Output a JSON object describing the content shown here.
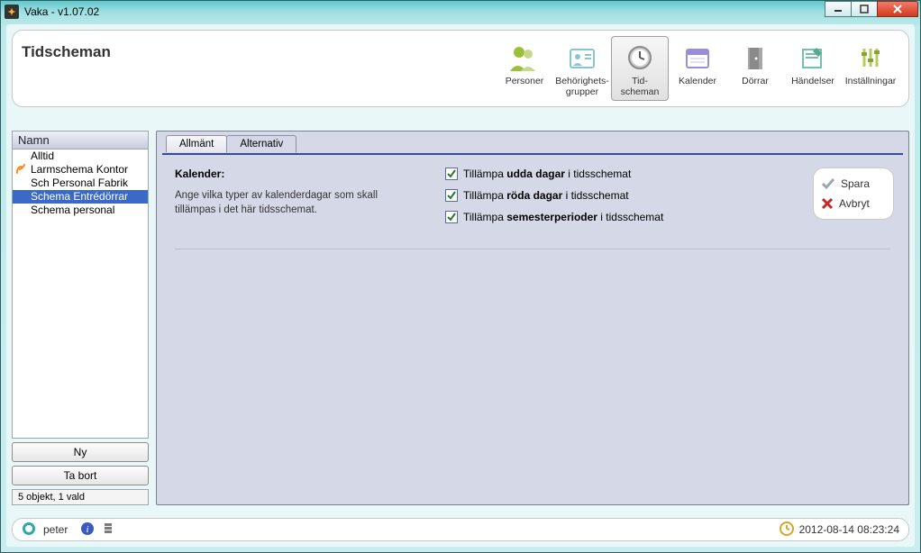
{
  "window": {
    "title": "Vaka - v1.07.02"
  },
  "toolbar": {
    "title": "Tidscheman",
    "buttons": {
      "personer": "Personer",
      "behorighets": "Behörighets-\ngrupper",
      "tidscheman": "Tid-\nscheman",
      "kalender": "Kalender",
      "dorrar": "Dörrar",
      "handelser": "Händelser",
      "installningar": "Inställningar"
    }
  },
  "sidebar": {
    "header": "Namn",
    "items": [
      {
        "label": "Alltid"
      },
      {
        "label": "Larmschema Kontor",
        "alarm": true
      },
      {
        "label": "Sch Personal Fabrik"
      },
      {
        "label": "Schema Entrédörrar",
        "selected": true
      },
      {
        "label": "Schema personal"
      }
    ],
    "btn_new": "Ny",
    "btn_delete": "Ta bort",
    "status": "5 objekt, 1 vald"
  },
  "tabs": {
    "allmant": "Allmänt",
    "alternativ": "Alternativ"
  },
  "form": {
    "heading": "Kalender:",
    "help": "Ange vilka typer av kalenderdagar som skall tillämpas i det här tidsschemat.",
    "c1_pre": "Tillämpa ",
    "c1_bold": "udda dagar",
    "c1_post": " i tidsschemat",
    "c2_pre": "Tillämpa ",
    "c2_bold": "röda dagar",
    "c2_post": " i tidsschemat",
    "c3_pre": "Tillämpa ",
    "c3_bold": "semesterperioder",
    "c3_post": " i tidsschemat"
  },
  "actions": {
    "save": "Spara",
    "cancel": "Avbryt"
  },
  "status": {
    "user": "peter",
    "datetime": "2012-08-14 08:23:24"
  }
}
